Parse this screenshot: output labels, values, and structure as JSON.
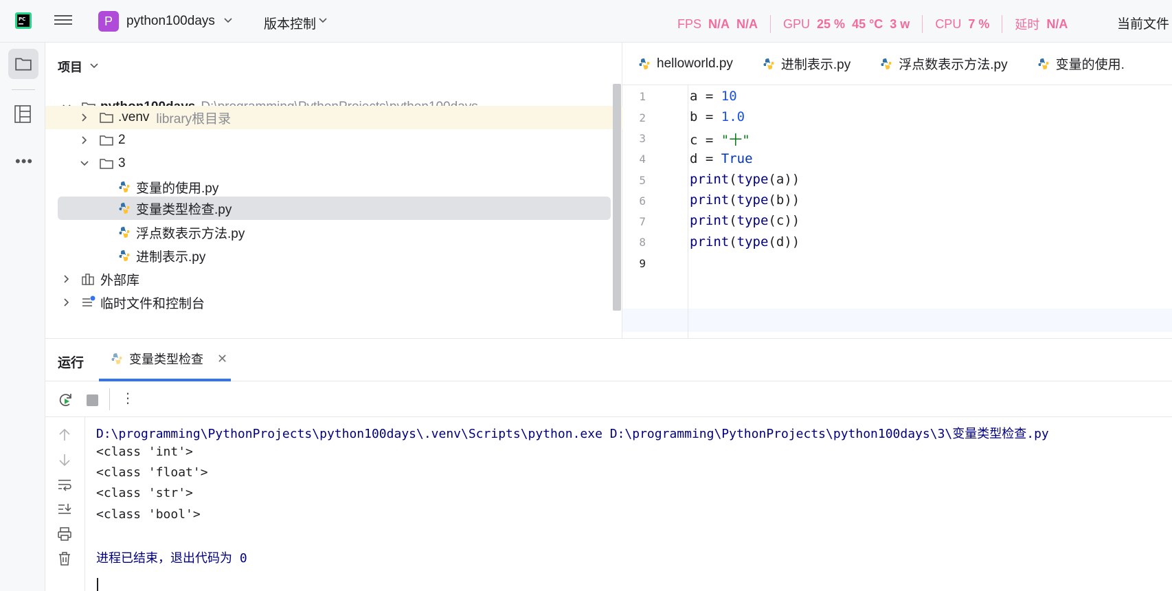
{
  "topbar": {
    "project_badge": "P",
    "project_name": "python100days",
    "vcs_label": "版本控制",
    "perf": {
      "fps_label": "FPS",
      "fps_val1": "N/A",
      "fps_val2": "N/A",
      "gpu_label": "GPU",
      "gpu_usage": "25 %",
      "gpu_temp": "45 °C",
      "gpu_power": "3 w",
      "cpu_label": "CPU",
      "cpu_usage": "7 %",
      "latency_label": "延时",
      "latency_val": "N/A"
    },
    "current_file_label": "当前文件"
  },
  "project_panel": {
    "title": "项目",
    "tree": {
      "root_name": "python100days",
      "root_path": "D:\\programming\\PythonProjects\\python100days",
      "venv_name": ".venv",
      "venv_hint": "library根目录",
      "folder2": "2",
      "folder3": "3",
      "file1": "变量的使用.py",
      "file2": "变量类型检查.py",
      "file3": "浮点数表示方法.py",
      "file4": "进制表示.py",
      "external_libs": "外部库",
      "scratches": "临时文件和控制台"
    }
  },
  "editor": {
    "tabs": [
      "helloworld.py",
      "进制表示.py",
      "浮点数表示方法.py",
      "变量的使用."
    ],
    "line_numbers": [
      "1",
      "2",
      "3",
      "4",
      "5",
      "6",
      "7",
      "8",
      "9"
    ],
    "code": {
      "l1_var": "a",
      "l1_op": " = ",
      "l1_val": "10",
      "l2_var": "b",
      "l2_op": " = ",
      "l2_val": "1.0",
      "l3_var": "c",
      "l3_op": " = ",
      "l3_val": "\"十\"",
      "l4_var": "d",
      "l4_op": " = ",
      "l4_val": "True",
      "print_fn": "print",
      "type_fn": "type",
      "arg_a": "a",
      "arg_b": "b",
      "arg_c": "c",
      "arg_d": "d"
    }
  },
  "run_panel": {
    "label": "运行",
    "tab_label": "变量类型检查",
    "output": {
      "command": "D:\\programming\\PythonProjects\\python100days\\.venv\\Scripts\\python.exe D:\\programming\\PythonProjects\\python100days\\3\\变量类型检查.py",
      "line1": "<class 'int'>",
      "line2": "<class 'float'>",
      "line3": "<class 'str'>",
      "line4": "<class 'bool'>",
      "exit_msg": "进程已结束，退出代码为 0"
    }
  },
  "colors": {
    "accent": "#3574f0",
    "perf": "#f26b9c",
    "selection": "#dfe1e5",
    "venv_highlight": "#fcf6e5"
  }
}
